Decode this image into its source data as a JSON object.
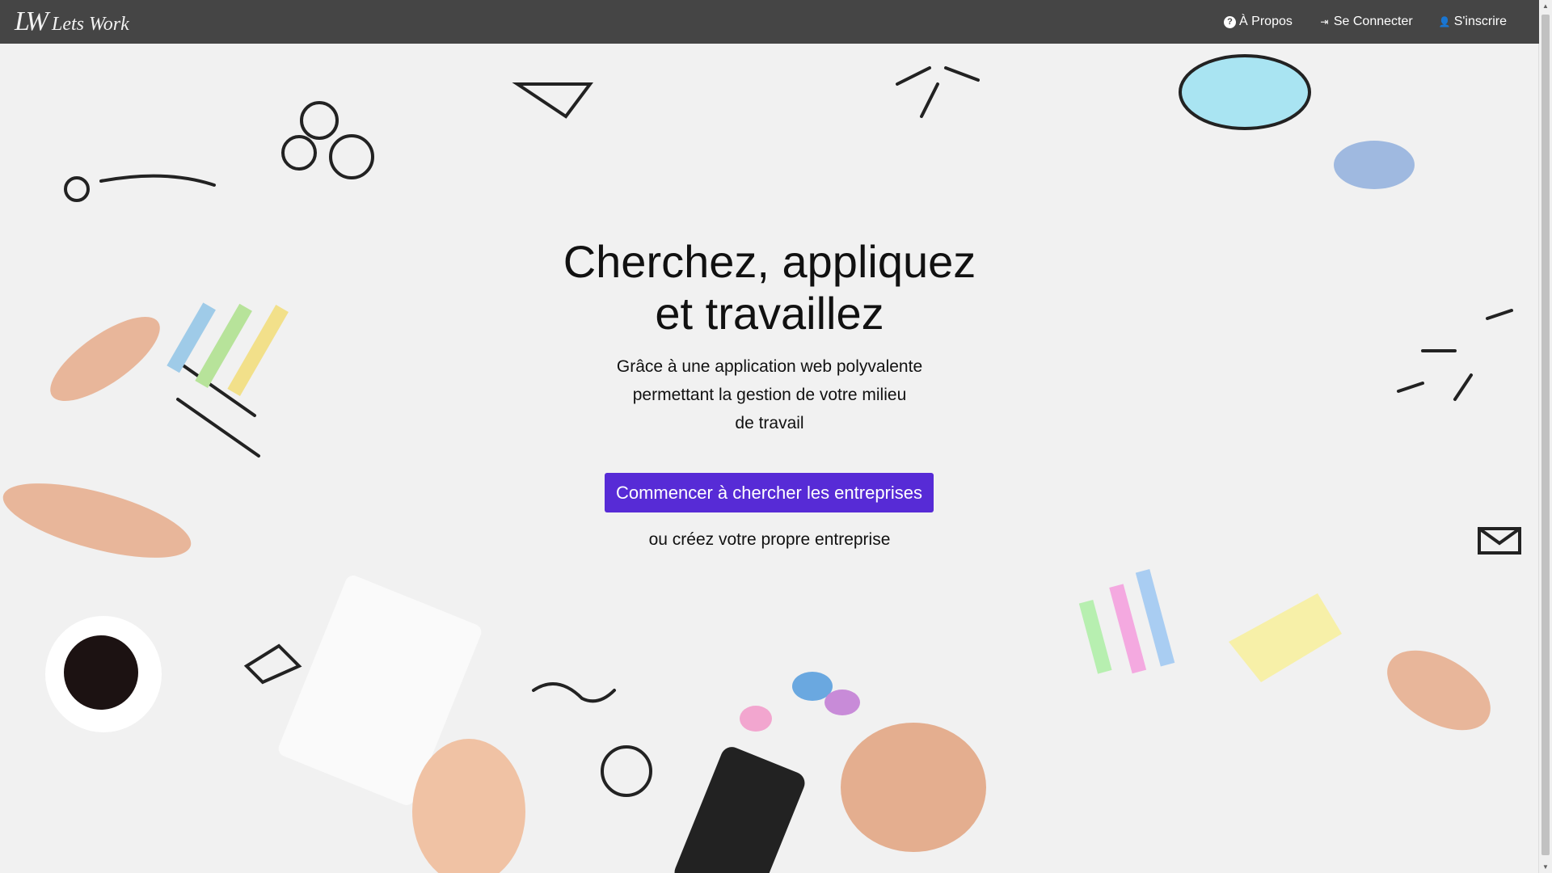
{
  "navbar": {
    "logo_mark": "LW",
    "brand": "Lets Work",
    "items": [
      {
        "label": "À Propos",
        "icon": "question-circle-icon"
      },
      {
        "label": "Se Connecter",
        "icon": "sign-in-icon"
      },
      {
        "label": "S'inscrire",
        "icon": "user-icon"
      }
    ]
  },
  "hero": {
    "title_line1": "Cherchez, appliquez",
    "title_line2": "et travaillez",
    "subtitle_line1": "Grâce à une application web polyvalente",
    "subtitle_line2": "permettant la gestion de votre milieu",
    "subtitle_line3": "de travail",
    "cta_label": "Commencer à chercher les entreprises",
    "secondary_link": "ou créez votre propre entreprise"
  },
  "colors": {
    "navbar": "#454545",
    "accent": "#572bd6",
    "background": "#f1f1f1"
  }
}
